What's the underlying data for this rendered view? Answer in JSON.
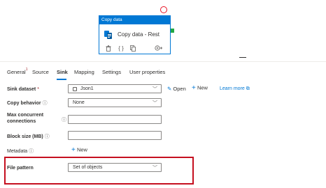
{
  "activity": {
    "header": "Copy data",
    "name": "Copy data - Rest",
    "icons": [
      "delete-icon",
      "code-icon",
      "copy-icon",
      "add-output-icon"
    ]
  },
  "tabs": [
    {
      "label": "General",
      "badge": "1"
    },
    {
      "label": "Source"
    },
    {
      "label": "Sink",
      "active": true
    },
    {
      "label": "Mapping"
    },
    {
      "label": "Settings"
    },
    {
      "label": "User properties"
    }
  ],
  "sink_dataset": {
    "label": "Sink dataset",
    "required_mark": "*",
    "value": "Json1",
    "open_label": "Open",
    "new_label": "New",
    "learn_more": "Learn more"
  },
  "copy_behavior": {
    "label": "Copy behavior",
    "value": "None"
  },
  "max_concurrent": {
    "label_line1": "Max concurrent",
    "label_line2": "connections",
    "value": ""
  },
  "block_size": {
    "label": "Block size (MB)",
    "value": ""
  },
  "metadata": {
    "label": "Metadata",
    "new_label": "New"
  },
  "file_pattern": {
    "label": "File pattern",
    "value": "Set of objects"
  },
  "colors": {
    "accent": "#0078d4",
    "highlight": "#c50f1f",
    "success": "#22a745"
  }
}
